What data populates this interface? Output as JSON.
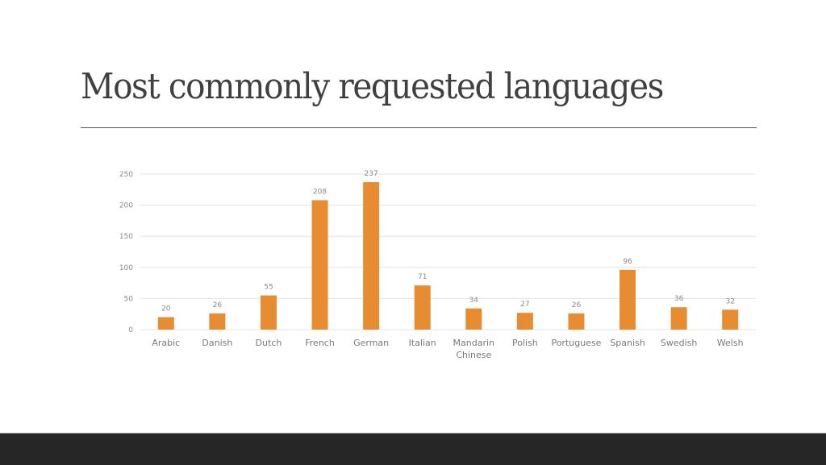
{
  "slide": {
    "title": "Most commonly requested languages"
  },
  "colors": {
    "bar": "#E88C32",
    "grid": "#e3e3e3",
    "footer": "#262626"
  },
  "chart_data": {
    "type": "bar",
    "title": "",
    "xlabel": "",
    "ylabel": "",
    "categories": [
      "Arabic",
      "Danish",
      "Dutch",
      "French",
      "German",
      "Italian",
      "Mandarin Chinese",
      "Polish",
      "Portuguese",
      "Spanish",
      "Swedish",
      "Welsh"
    ],
    "category_lines": [
      [
        "Arabic"
      ],
      [
        "Danish"
      ],
      [
        "Dutch"
      ],
      [
        "French"
      ],
      [
        "German"
      ],
      [
        "Italian"
      ],
      [
        "Mandarin",
        "Chinese"
      ],
      [
        "Polish"
      ],
      [
        "Portuguese"
      ],
      [
        "Spanish"
      ],
      [
        "Swedish"
      ],
      [
        "Welsh"
      ]
    ],
    "values": [
      20,
      26,
      55,
      208,
      237,
      71,
      34,
      27,
      26,
      96,
      36,
      32
    ],
    "ylim": [
      0,
      250
    ],
    "yticks": [
      0,
      50,
      100,
      150,
      200,
      250
    ],
    "grid": true,
    "data_labels": true,
    "legend": "none"
  }
}
